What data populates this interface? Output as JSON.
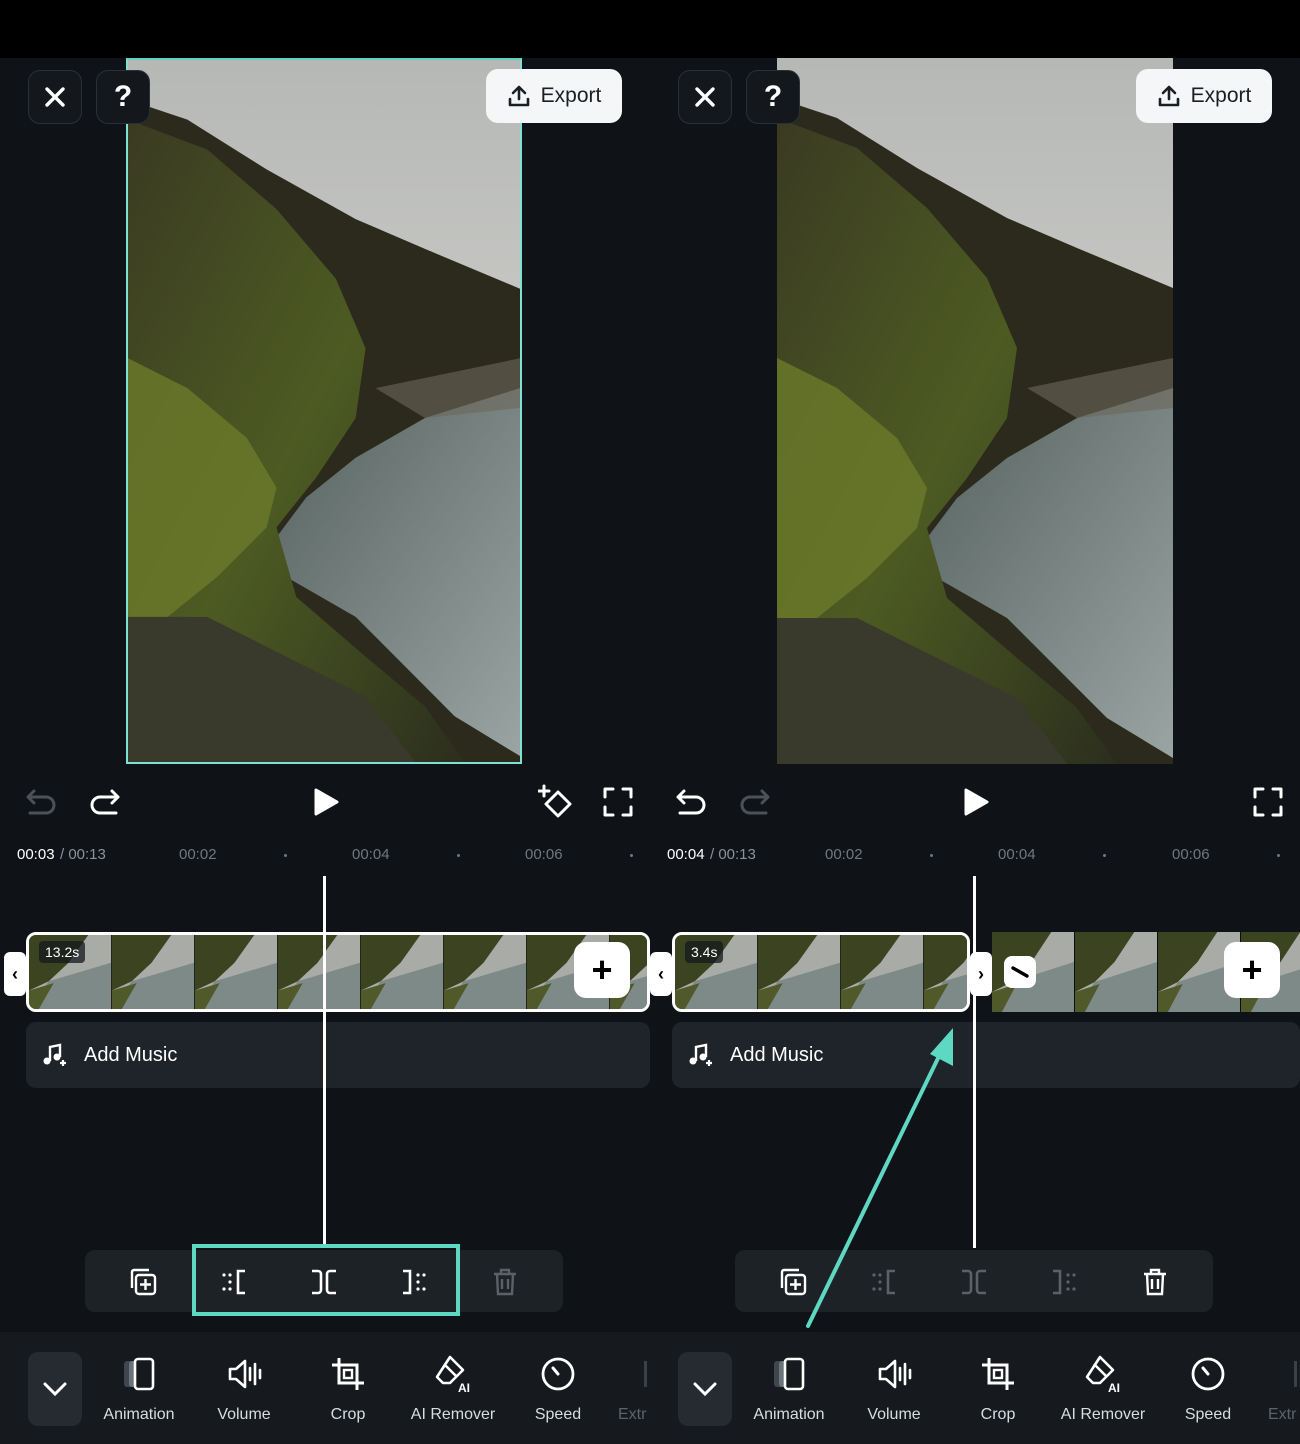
{
  "export_label": "Export",
  "left": {
    "time_current": "00:03",
    "time_total": " / 00:13",
    "ticks": [
      "00:02",
      "00:04",
      "00:06"
    ],
    "clip_duration": "13.2s",
    "add_music": "Add Music"
  },
  "right": {
    "time_current": "00:04",
    "time_total": " / 00:13",
    "ticks": [
      "00:02",
      "00:04",
      "00:06"
    ],
    "clip_duration": "3.4s",
    "add_music": "Add Music"
  },
  "tools": [
    "Animation",
    "Volume",
    "Crop",
    "AI Remover",
    "Speed",
    "Extr"
  ],
  "colors": {
    "accent": "#5fd8c3",
    "background": "#0f1317"
  }
}
